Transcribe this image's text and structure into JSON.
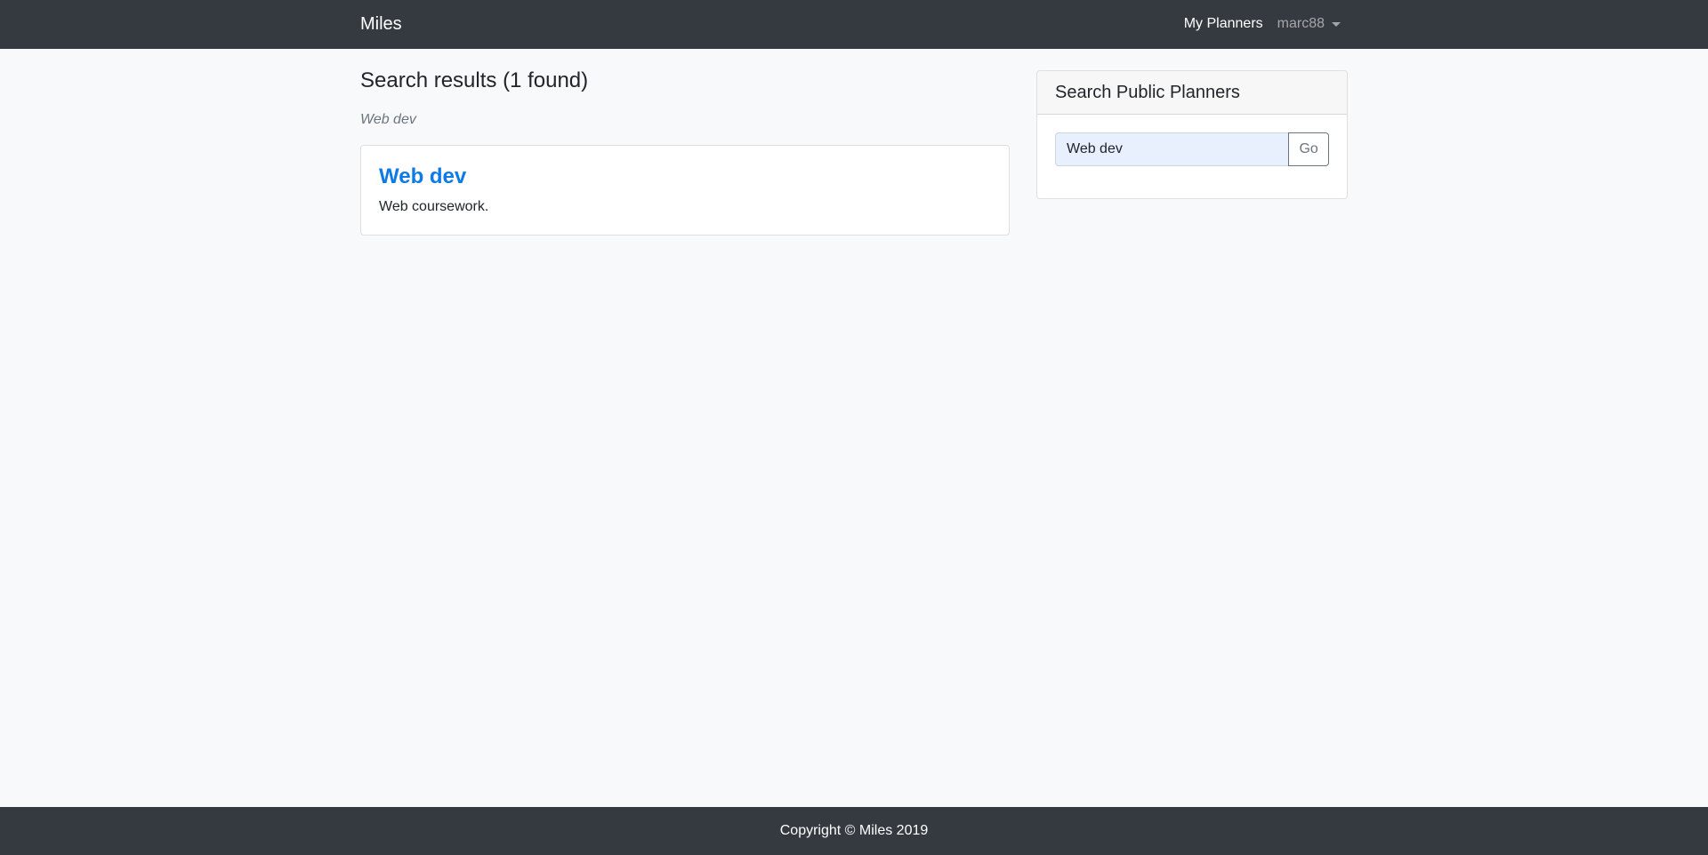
{
  "navbar": {
    "brand": "Miles",
    "my_planners": "My Planners",
    "username": "marc88",
    "user_menu_icon": "caret-down-icon"
  },
  "main": {
    "results_title": "Search results (1 found)",
    "query": "Web dev",
    "results": [
      {
        "title": "Web dev",
        "description": "Web coursework."
      }
    ]
  },
  "sidebar": {
    "title": "Search Public Planners",
    "search_value": "Web dev",
    "go_label": "Go"
  },
  "footer": {
    "text": "Copyright © Miles 2019"
  },
  "colors": {
    "navbar_bg": "#343a40",
    "link": "#0d7ae8",
    "page_bg": "#f8f9fa",
    "input_bg": "#e8f0fe"
  }
}
